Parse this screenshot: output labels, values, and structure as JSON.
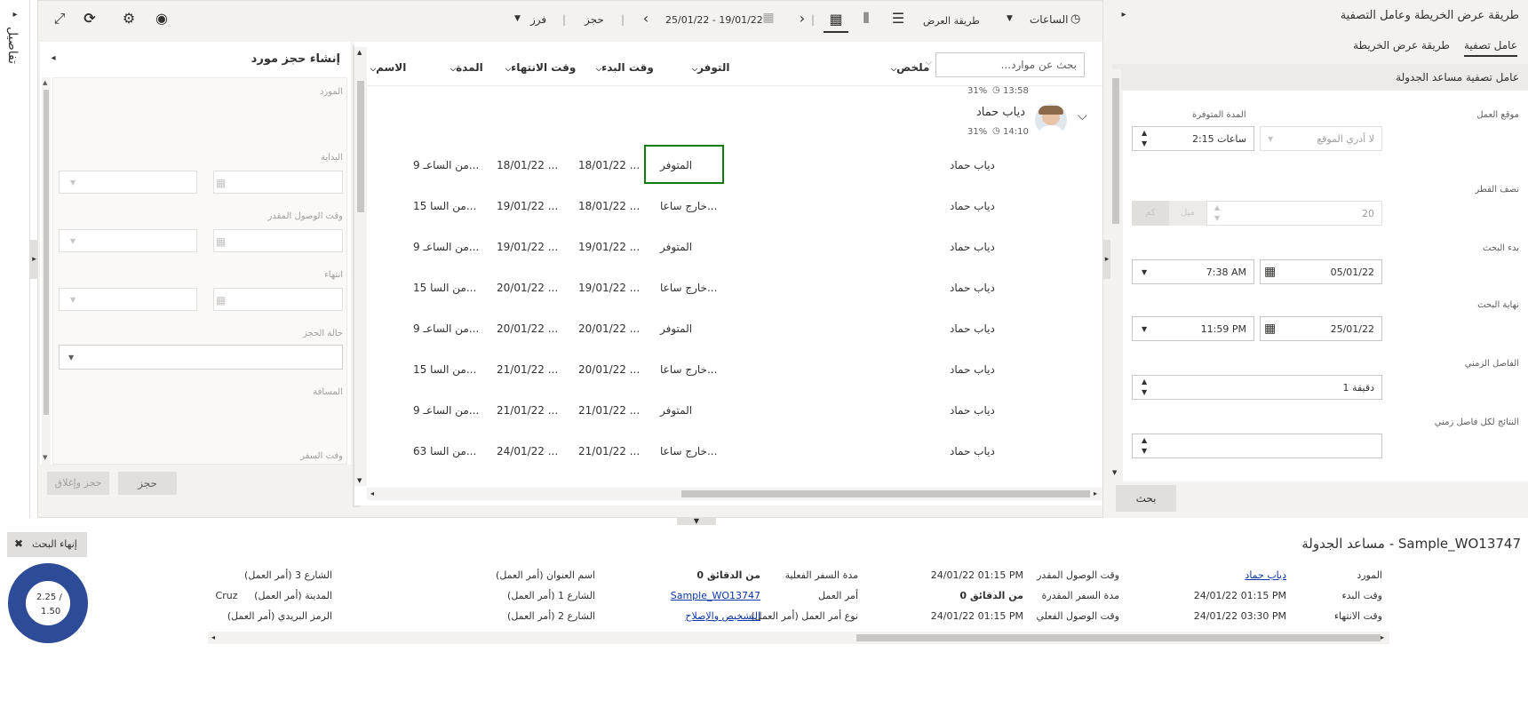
{
  "left_rail": {
    "toggle": "▸",
    "label": "تفاصيل"
  },
  "toolbar": {
    "expand_icon": "expand-icon",
    "refresh_icon": "refresh-icon",
    "gear_icon": "gear-icon",
    "eye_icon": "eye-icon",
    "sort_label": "فرز",
    "book_label": "حجز",
    "date_range": "25/01/22 - 19/01/22",
    "view_label": "طريقة العرض",
    "hours_label": "الساعات"
  },
  "create_panel": {
    "title": "إنشاء حجز مورد",
    "fields": [
      "المورد",
      "البداية",
      "وقت الوصول المقدر",
      "انتهاء",
      "حالة الحجز",
      "المسافة",
      "وقت السفر"
    ],
    "book_button": "حجز",
    "book_close_button": "حجز وإغلاق"
  },
  "grid": {
    "search_placeholder": "بحث عن موارد...",
    "columns": [
      "ملخص",
      "التوفر",
      "وقت البدء",
      "وقت الانتهاء",
      "المدة",
      "الاسم"
    ],
    "resource_name": "دياب حماد",
    "top_partial": {
      "time": "13:58",
      "percent": "31%"
    },
    "resource_card": {
      "time": "14:10",
      "percent": "31%"
    },
    "rows": [
      {
        "name": "دياب حماد",
        "availability": "المتوفر",
        "start": "18/01/22 ...",
        "end": "18/01/22 ...",
        "duration": "9 من الساعـ..."
      },
      {
        "name": "دياب حماد",
        "availability": "خارج ساعا...",
        "start": "18/01/22 ...",
        "end": "19/01/22 ...",
        "duration": "15 من السا..."
      },
      {
        "name": "دياب حماد",
        "availability": "المتوفر",
        "start": "19/01/22 ...",
        "end": "19/01/22 ...",
        "duration": "9 من الساعـ..."
      },
      {
        "name": "دياب حماد",
        "availability": "خارج ساعا...",
        "start": "19/01/22 ...",
        "end": "20/01/22 ...",
        "duration": "15 من السا..."
      },
      {
        "name": "دياب حماد",
        "availability": "المتوفر",
        "start": "20/01/22 ...",
        "end": "20/01/22 ...",
        "duration": "9 من الساعـ..."
      },
      {
        "name": "دياب حماد",
        "availability": "خارج ساعا...",
        "start": "20/01/22 ...",
        "end": "21/01/22 ...",
        "duration": "15 من السا..."
      },
      {
        "name": "دياب حماد",
        "availability": "المتوفر",
        "start": "21/01/22 ...",
        "end": "21/01/22 ...",
        "duration": "9 من الساعـ..."
      },
      {
        "name": "دياب حماد",
        "availability": "خارج ساعا...",
        "start": "21/01/22 ...",
        "end": "24/01/22 ...",
        "duration": "63 من السا..."
      }
    ]
  },
  "filter_panel": {
    "title": "طريقة عرض الخريطة وعامل التصفية",
    "tabs": [
      "عامل تصفية",
      "طريقة عرض الخريطة"
    ],
    "section_title": "عامل تصفية مساعد الجدولة",
    "work_location_label": "موقع العمل",
    "work_location_value": "لا أدري الموقع",
    "available_duration_label": "المدة المتوفرة",
    "available_duration_value": "2:15 ساعات",
    "radius_label": "نصف القطر",
    "radius_value": "20",
    "radius_unit_mile": "ميل",
    "radius_unit_km": "كم",
    "search_start_label": "بدء البحث",
    "search_start_date": "05/01/22",
    "search_start_time": "7:38 AM",
    "search_end_label": "نهاية البحث",
    "search_end_date": "25/01/22",
    "search_end_time": "11:59 PM",
    "interval_label": "الفاصل الزمني",
    "interval_value": "1 دقيقة",
    "results_label": "النتائج لكل فاصل زمني",
    "search_button": "بحث"
  },
  "bottom": {
    "title": "مساعد الجدولة - Sample_WO13747",
    "end_search_button": "إنهاء البحث",
    "donut_top": "2.25 /",
    "donut_bottom": "1.50",
    "donut_ring_color": "#2d4b96",
    "col1": [
      {
        "label": "المورد",
        "value": "دياب حماد",
        "link": true
      },
      {
        "label": "وقت البدء",
        "value": "24/01/22 01:15 PM"
      },
      {
        "label": "وقت الانتهاء",
        "value": "24/01/22 03:30 PM"
      }
    ],
    "col2": [
      {
        "label": "وقت الوصول المقدر",
        "value": "24/01/22 01:15 PM"
      },
      {
        "label": "مدة السفر المقدرة",
        "value": "0 من الدقائق",
        "bold": true
      },
      {
        "label": "وقت الوصول الفعلي",
        "value": "24/01/22 01:15 PM"
      }
    ],
    "col3": [
      {
        "label": "مدة السفر الفعلية",
        "value": "0 من الدقائق",
        "bold": true
      },
      {
        "label": "أمر العمل",
        "value": "Sample_WO13747",
        "link": true
      },
      {
        "label": "نوع أمر العمل (أمر العمل)",
        "value": "التشخيص والإصلاح",
        "link": true
      }
    ],
    "col4": [
      {
        "label": "اسم العنوان (أمر العمل)"
      },
      {
        "label": "الشارع 1 (أمر العمل)"
      },
      {
        "label": "الشارع 2 (أمر العمل)"
      }
    ],
    "col5": [
      {
        "label": "الشارع 3 (أمر العمل)"
      },
      {
        "label": "المدينة (أمر العمل)",
        "value": "ta Cruz"
      },
      {
        "label": "الرمز البريدي (أمر العمل)"
      }
    ]
  }
}
